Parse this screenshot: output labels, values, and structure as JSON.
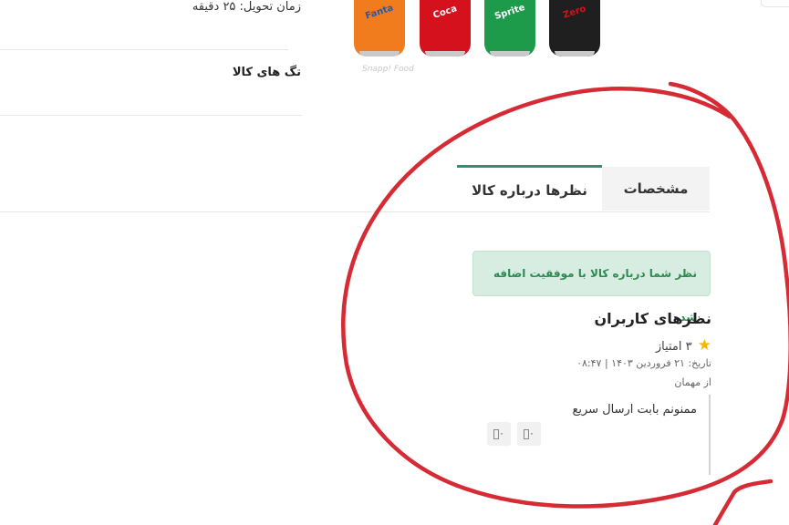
{
  "product": {
    "delivery_time": "زمان تحویل: ۲۵ دقیقه",
    "tags_label": "تگ های کالا",
    "watermark": "Snapp! Food",
    "can_labels": [
      "Fanta",
      "Coca",
      "Sprite",
      "Zero"
    ],
    "can_colors": [
      "#f07c1e",
      "#d6111e",
      "#1d9a4a",
      "#1f1f1f"
    ]
  },
  "tabs": {
    "specs": "مشخصات",
    "reviews": "نظرها درباره کالا"
  },
  "reviews": {
    "success_message": "نظر شما درباره کالا با موفقیت اضافه شد.",
    "title": "نظرهای کاربران",
    "items": [
      {
        "rating_text": "۳ امتیاز",
        "date": "تاریخ: ۲۱ فروردین ۱۴۰۳ | ۰۸:۴۷",
        "author": "از مهمان",
        "text": "ممنونم بابت ارسال سریع",
        "like_count": "۰",
        "dislike_count": "۰"
      }
    ]
  },
  "colors": {
    "accent": "#2f8f6f",
    "success_bg": "#d8ede2",
    "success_text": "#2f8a52",
    "annotation": "#d62b35"
  },
  "icons": {
    "rating": "star-icon",
    "like": "thumb-up-icon",
    "dislike": "thumb-down-icon"
  }
}
